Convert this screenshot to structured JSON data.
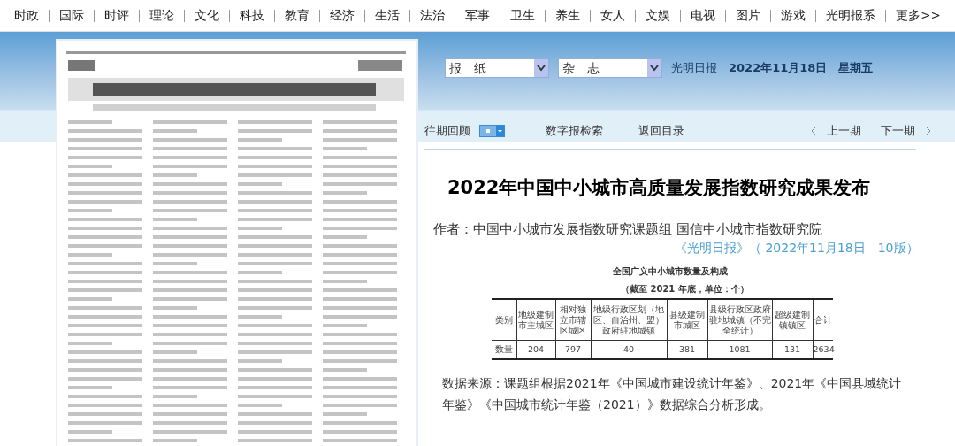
{
  "nav": {
    "items": [
      "时政",
      "国际",
      "时评",
      "理论",
      "文化",
      "科技",
      "教育",
      "经济",
      "生活",
      "法治",
      "军事",
      "卫生",
      "养生",
      "女人",
      "文娱",
      "电视",
      "图片",
      "游戏",
      "光明报系",
      "更多>>"
    ]
  },
  "selectors": [
    {
      "value": "报　纸"
    },
    {
      "value": "杂　志"
    }
  ],
  "masthead": {
    "paper": "光明日报",
    "date": "2022年11月18日",
    "weekday": "星期五"
  },
  "toolbar": {
    "archive": "往期回顾",
    "search": "数字报检索",
    "back": "返回目录",
    "prev": "上一期",
    "next": "下一期"
  },
  "article": {
    "title": "2022年中国中小城市高质量发展指数研究成果发布",
    "author": "作者：中国中小城市发展指数研究课题组 国信中小城市指数研究院",
    "source": "《光明日报》（ 2022年11月18日　10版）",
    "table": {
      "caption": "全国广义中小城市数量及构成",
      "subcaption": "（截至 2021 年底，单位：个）",
      "columns": [
        "类别",
        "地级建制市主城区",
        "相对独立市辖区城区",
        "地级行政区划（地区、自治州、盟）政府驻地城镇",
        "县级建制市城区",
        "县级行政区政府驻地城镇（不完全统计）",
        "超级建制镇镇区",
        "合计"
      ],
      "rows": [
        [
          "数量",
          "204",
          "797",
          "40",
          "381",
          "1081",
          "131",
          "2634"
        ]
      ]
    },
    "note": "数据来源：课题组根据2021年《中国城市建设统计年鉴》、2021年《中国县域统计年鉴》《中国城市统计年鉴（2021）》数据综合分析形成。"
  }
}
